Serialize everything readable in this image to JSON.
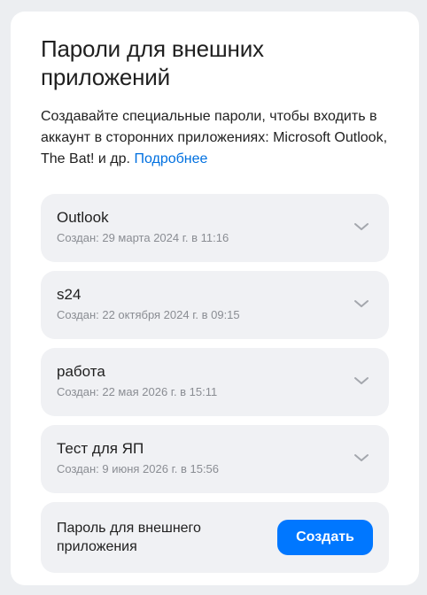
{
  "page": {
    "title": "Пароли для внешних приложений",
    "description": "Создавайте специальные пароли, чтобы входить в аккаунт в сторонних приложениях: Microsoft Outlook, The Bat! и др.",
    "more_link": "Подробнее"
  },
  "passwords": [
    {
      "name": "Outlook",
      "created": "Создан: 29 марта 2024 г. в 11:16"
    },
    {
      "name": "s24",
      "created": "Создан: 22 октября 2024 г. в 09:15"
    },
    {
      "name": "работа",
      "created": "Создан: 22 мая 2026 г. в 15:11"
    },
    {
      "name": "Тест для ЯП",
      "created": "Создан: 9 июня 2026 г. в 15:56"
    }
  ],
  "create": {
    "label": "Пароль для внешнего приложения",
    "button": "Создать"
  },
  "icons": {
    "expand": "chevron-down-icon"
  },
  "colors": {
    "accent": "#0077ff",
    "link": "#0070e0",
    "item_bg": "#f0f1f4",
    "page_bg": "#eceef1",
    "secondary_text": "#8a8d93"
  }
}
